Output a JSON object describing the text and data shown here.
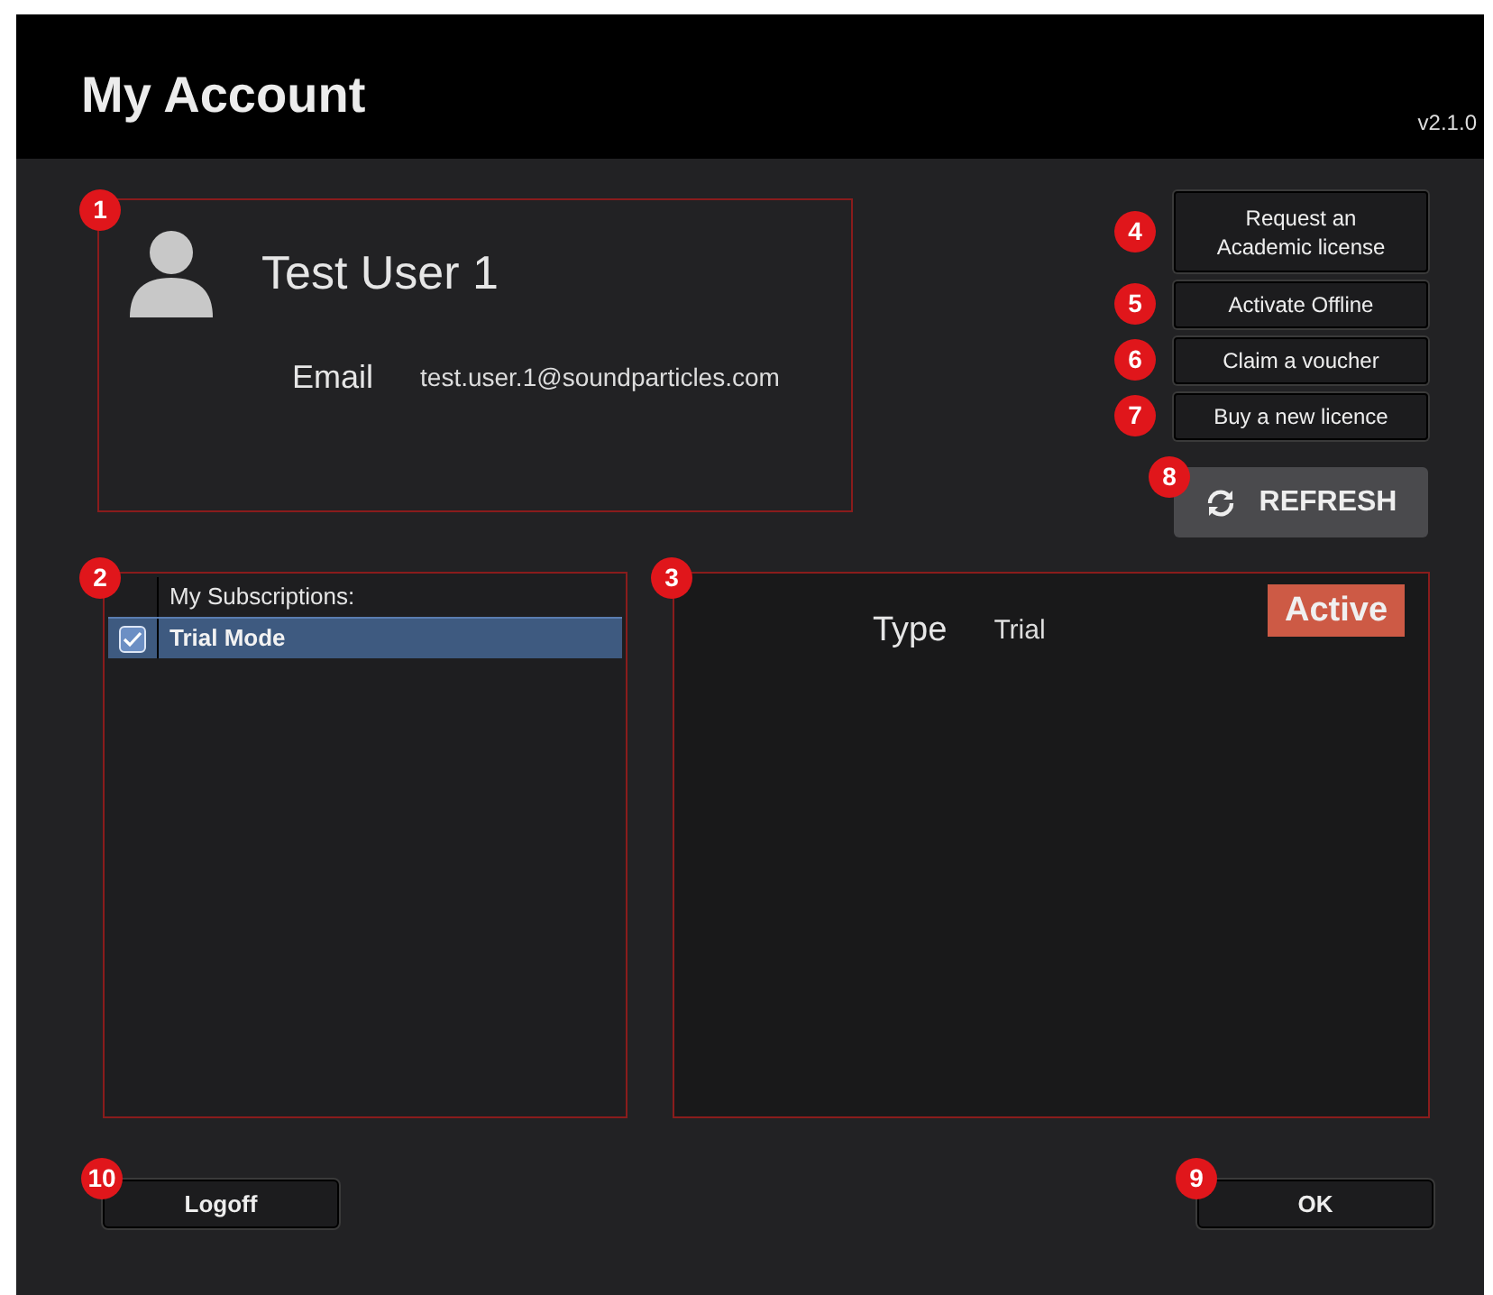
{
  "window": {
    "title": "My Account",
    "version": "v2.1.0"
  },
  "account": {
    "callout": "1",
    "name": "Test User 1",
    "email_label": "Email",
    "email": "test.user.1@soundparticles.com"
  },
  "actions": [
    {
      "label": "Request an Academic license",
      "callout": "4"
    },
    {
      "label": "Activate Offline",
      "callout": "5"
    },
    {
      "label": "Claim a voucher",
      "callout": "6"
    },
    {
      "label": "Buy a new licence",
      "callout": "7"
    }
  ],
  "refresh": {
    "label": "REFRESH",
    "callout": "8"
  },
  "subscriptions": {
    "callout": "2",
    "header": "My Subscriptions:",
    "items": [
      {
        "label": "Trial Mode",
        "checked": true,
        "selected": true
      }
    ]
  },
  "details": {
    "callout": "3",
    "type_label": "Type",
    "type_value": "Trial",
    "status": "Active"
  },
  "footer": {
    "logoff": {
      "label": "Logoff",
      "callout": "10"
    },
    "ok": {
      "label": "OK",
      "callout": "9"
    }
  }
}
